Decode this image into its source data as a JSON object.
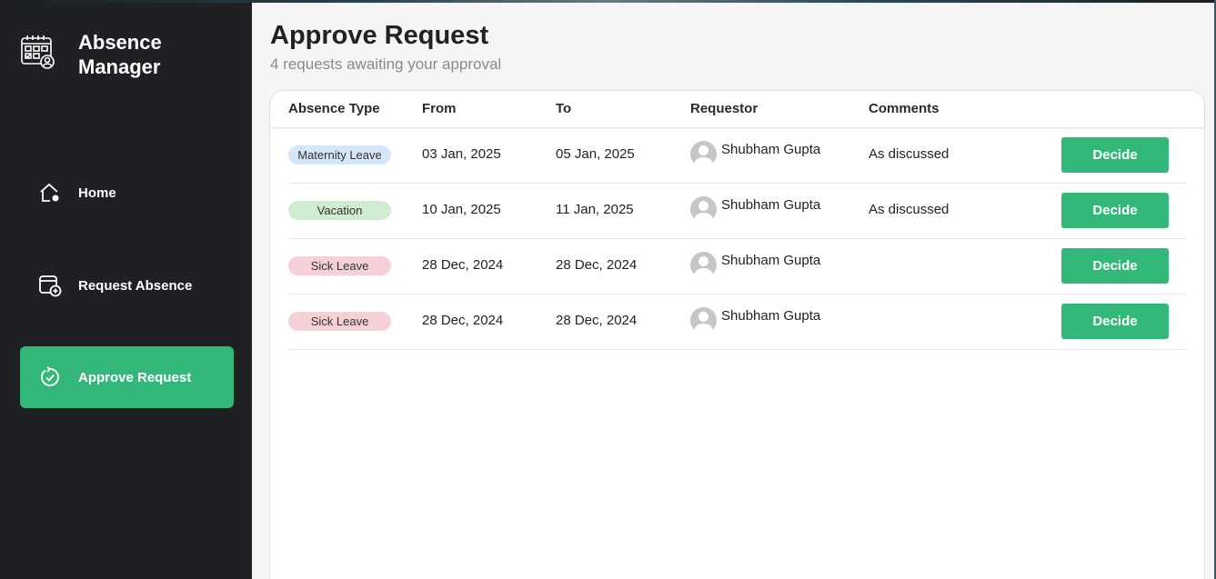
{
  "app": {
    "title": "Absence\nManager"
  },
  "sidebar": {
    "items": [
      {
        "label": "Home",
        "icon": "home-icon",
        "active": false
      },
      {
        "label": "Request Absence",
        "icon": "calendar-add-icon",
        "active": false
      },
      {
        "label": "Approve Request",
        "icon": "refresh-check-icon",
        "active": true
      }
    ]
  },
  "page": {
    "title": "Approve Request",
    "subtitle": "4 requests awaiting your approval"
  },
  "table": {
    "columns": [
      "Absence Type",
      "From",
      "To",
      "Requestor",
      "Comments"
    ],
    "rows": [
      {
        "type": "Maternity Leave",
        "from": "03 Jan, 2025",
        "to": "05 Jan, 2025",
        "requestor": "Shubham Gupta",
        "comments": "As discussed",
        "action": "Decide"
      },
      {
        "type": "Vacation",
        "from": "10 Jan, 2025",
        "to": "11 Jan, 2025",
        "requestor": "Shubham Gupta",
        "comments": "As discussed",
        "action": "Decide"
      },
      {
        "type": "Sick Leave",
        "from": "28 Dec, 2024",
        "to": "28 Dec, 2024",
        "requestor": "Shubham Gupta",
        "comments": "",
        "action": "Decide"
      },
      {
        "type": "Sick Leave",
        "from": "28 Dec, 2024",
        "to": "28 Dec, 2024",
        "requestor": "Shubham Gupta",
        "comments": "",
        "action": "Decide"
      }
    ]
  },
  "colors": {
    "accent": "#34b87a",
    "sidebar_bg": "#1f2023",
    "badge_maternity": "#d4e6f7",
    "badge_vacation": "#cfeccf",
    "badge_sick": "#f5d0d6"
  }
}
